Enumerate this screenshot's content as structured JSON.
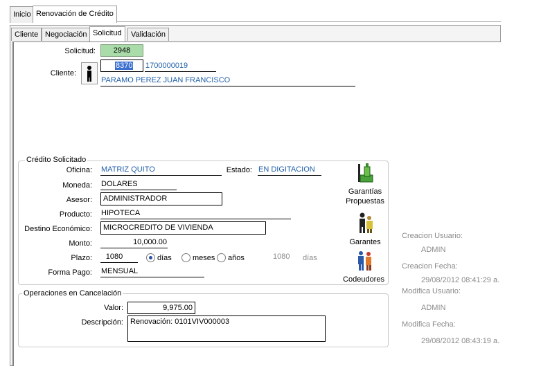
{
  "tabs": {
    "inicio": "Inicio",
    "renovacion": "Renovación de Crédito"
  },
  "subtabs": {
    "cliente": "Cliente",
    "negociacion": "Negociación",
    "solicitud": "Solicitud",
    "validacion": "Validación"
  },
  "header": {
    "solicitud_label": "Solicitud:",
    "solicitud_value": "2948",
    "cliente_label": "Cliente:",
    "cliente_code": "8370",
    "cliente_id": "1700000019",
    "cliente_name": "PARAMO PEREZ JUAN FRANCISCO"
  },
  "credito": {
    "title": "Crédito Solicitado",
    "oficina_label": "Oficina:",
    "oficina_value": "MATRIZ QUITO",
    "estado_label": "Estado:",
    "estado_value": "EN DIGITACION",
    "moneda_label": "Moneda:",
    "moneda_value": "DOLARES",
    "asesor_label": "Asesor:",
    "asesor_value": "ADMINISTRADOR",
    "producto_label": "Producto:",
    "producto_value": "HIPOTECA",
    "destino_label": "Destino Económico:",
    "destino_value": "MICROCREDITO DE VIVIENDA",
    "monto_label": "Monto:",
    "monto_value": "10,000.00",
    "plazo_label": "Plazo:",
    "plazo_value": "1080",
    "opt_dias": "días",
    "opt_meses": "meses",
    "opt_anios": "años",
    "plazo_total": "1080",
    "plazo_total_unit": "días",
    "forma_label": "Forma Pago:",
    "forma_value": "MENSUAL",
    "garantias_label_1": "Garantías",
    "garantias_label_2": "Propuestas",
    "garantes_label": "Garantes",
    "codeudores_label": "Codeudores"
  },
  "operaciones": {
    "title": "Operaciones en Cancelación",
    "valor_label": "Valor:",
    "valor_value": "9,975.00",
    "descripcion_label": "Descripción:",
    "descripcion_value": "Renovación: 0101VIV000003"
  },
  "audit": {
    "creacion_usuario_label": "Creacion Usuario:",
    "creacion_usuario_value": "ADMIN",
    "creacion_fecha_label": "Creacion Fecha:",
    "creacion_fecha_value": "29/08/2012 08:41:29 a.",
    "modifica_usuario_label": "Modifica Usuario:",
    "modifica_usuario_value": "ADMIN",
    "modifica_fecha_label": "Modifica Fecha:",
    "modifica_fecha_value": "29/08/2012 08:43:19 a."
  }
}
